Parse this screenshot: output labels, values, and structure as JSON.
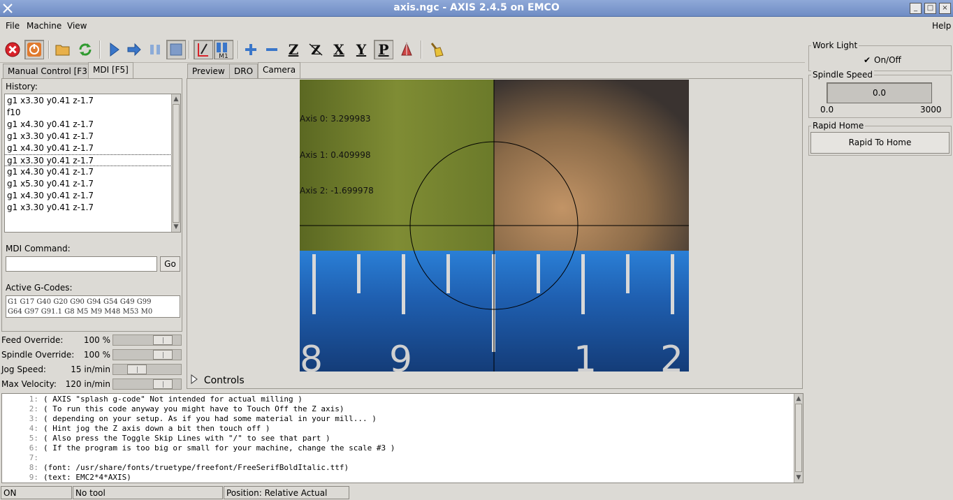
{
  "window": {
    "title": "axis.ngc - AXIS 2.4.5 on EMCO"
  },
  "menu": {
    "file": "File",
    "machine": "Machine",
    "view": "View",
    "help": "Help"
  },
  "toolbar": {
    "icons": [
      "estop-icon",
      "power-icon",
      "open-icon",
      "reload-icon",
      "run-icon",
      "step-icon",
      "pause-icon",
      "stop-icon",
      "skip-lines-icon",
      "optional-stop-icon",
      "zoom-in-icon",
      "zoom-out-icon",
      "view-z-icon",
      "view-z2-icon",
      "view-x-icon",
      "view-y-icon",
      "view-p-icon",
      "rotate-icon",
      "clear-plot-icon"
    ],
    "view_z": "Z",
    "view_x": "X",
    "view_y": "Y",
    "view_p": "P",
    "m1": "M1"
  },
  "left_tabs": {
    "manual": "Manual Control [F3]",
    "mdi": "MDI [F5]"
  },
  "mdi": {
    "history_label": "History:",
    "history": [
      "g1 x3.30 y0.41 z-1.7",
      "f10",
      "g1 x4.30 y0.41 z-1.7",
      "g1 x3.30 y0.41 z-1.7",
      "g1 x4.30 y0.41 z-1.7",
      "g1 x3.30 y0.41 z-1.7",
      "g1 x4.30 y0.41 z-1.7",
      "g1 x5.30 y0.41 z-1.7",
      "g1 x4.30 y0.41 z-1.7",
      "g1 x3.30 y0.41 z-1.7"
    ],
    "selected_index": 5,
    "command_label": "MDI Command:",
    "command_value": "",
    "go_label": "Go",
    "gcodes_label": "Active G-Codes:",
    "gcodes_line1": "G1 G17 G40 G20 G90 G94 G54 G49 G99",
    "gcodes_line2": "G64 G97 G91.1 G8 M5 M9 M48 M53 M0"
  },
  "overrides": {
    "feed": {
      "label": "Feed Override:",
      "value": "100 %",
      "level": 0.85
    },
    "spindle": {
      "label": "Spindle Override:",
      "value": "100 %",
      "level": 0.85
    },
    "jog": {
      "label": "Jog Speed:",
      "value": "15 in/min",
      "level": 0.3
    },
    "maxvel": {
      "label": "Max Velocity:",
      "value": "120 in/min",
      "level": 0.85
    }
  },
  "view_tabs": {
    "preview": "Preview",
    "dro": "DRO",
    "camera": "Camera"
  },
  "camera": {
    "axis0": "Axis 0: 3.299983",
    "axis1": "Axis 1: 0.409998",
    "axis2": "Axis 2: -1.699978",
    "scale_digits": [
      "8",
      "9",
      "1",
      "2"
    ]
  },
  "controls_label": "Controls",
  "gcode_lines": [
    {
      "n": "1:",
      "t": "( AXIS \"splash g-code\" Not intended for actual milling )"
    },
    {
      "n": "2:",
      "t": "( To run this code anyway you might have to Touch Off the Z axis)"
    },
    {
      "n": "3:",
      "t": "( depending on your setup. As if you had some material in your mill... )"
    },
    {
      "n": "4:",
      "t": "( Hint jog the Z axis down a bit then touch off )"
    },
    {
      "n": "5:",
      "t": "( Also press the Toggle Skip Lines with \"/\" to see that part )"
    },
    {
      "n": "6:",
      "t": "( If the program is too big or small for your machine, change the scale #3 )"
    },
    {
      "n": "7:",
      "t": ""
    },
    {
      "n": "8:",
      "t": "(font: /usr/share/fonts/truetype/freefont/FreeSerifBoldItalic.ttf)"
    },
    {
      "n": "9:",
      "t": "(text: EMC2*4*AXIS)"
    }
  ],
  "status": {
    "state": "ON",
    "tool": "No tool",
    "position": "Position: Relative Actual"
  },
  "work_light": {
    "title": "Work Light",
    "checkbox_label": "On/Off",
    "checked": true
  },
  "spindle_speed": {
    "title": "Spindle Speed",
    "value": "0.0",
    "min": "0.0",
    "max": "3000"
  },
  "rapid_home": {
    "title": "Rapid Home",
    "button": "Rapid To Home"
  },
  "colors": {
    "titlebar": "#7f9bd0",
    "scale_blue": "#1f5fb0",
    "metal_green": "#6c7a2a",
    "copper": "#b08a5a"
  }
}
